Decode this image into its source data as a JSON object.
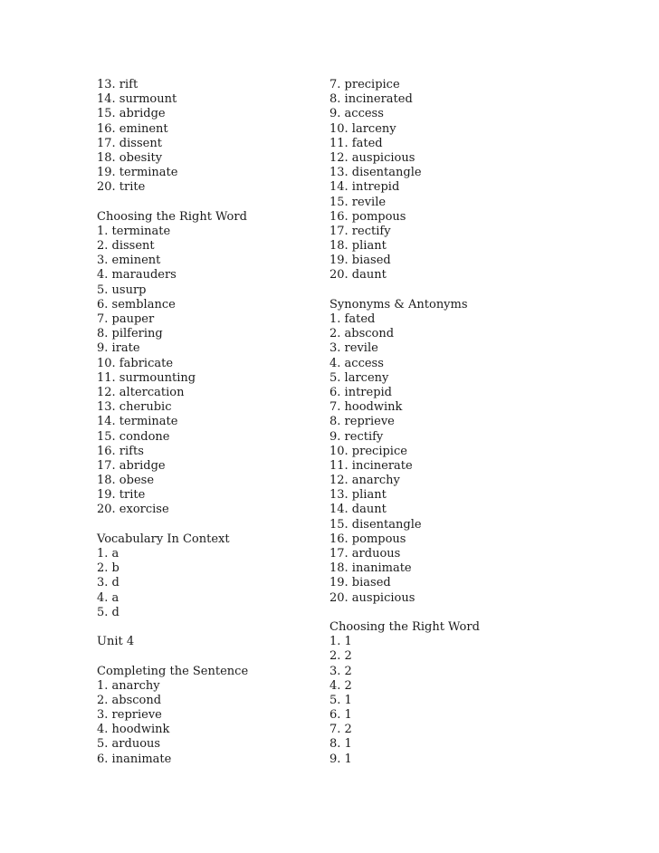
{
  "left_column": [
    {
      "heading": null,
      "items": [
        "13. rift",
        "14. surmount",
        "15. abridge",
        "16. eminent",
        "17. dissent",
        "18. obesity",
        "19. terminate",
        "20. trite"
      ]
    },
    {
      "heading": "Choosing the Right Word",
      "items": [
        "1. terminate",
        "2. dissent",
        "3. eminent",
        "4. marauders",
        "5. usurp",
        "6. semblance",
        "7. pauper",
        "8. pilfering",
        "9. irate",
        "10. fabricate",
        "11. surmounting",
        "12. altercation",
        "13. cherubic",
        "14. terminate",
        "15. condone",
        "16. rifts",
        "17. abridge",
        "18. obese",
        "19. trite",
        "20. exorcise"
      ]
    },
    {
      "heading": "Vocabulary In Context",
      "items": [
        "1. a",
        "2. b",
        "3. d",
        "4. a",
        "5. d"
      ]
    },
    {
      "heading": "Unit 4",
      "items": []
    },
    {
      "heading": "Completing the Sentence",
      "items": [
        "1. anarchy",
        "2. abscond",
        "3. reprieve",
        "4. hoodwink",
        "5. arduous",
        "6. inanimate"
      ]
    }
  ],
  "right_column": [
    {
      "heading": null,
      "items": [
        "7. precipice",
        "8. incinerated",
        "9. access",
        "10. larceny",
        "11. fated",
        "12. auspicious",
        "13. disentangle",
        "14. intrepid",
        "15. revile",
        "16. pompous",
        "17. rectify",
        "18. pliant",
        "19. biased",
        "20. daunt"
      ]
    },
    {
      "heading": "Synonyms & Antonyms",
      "items": [
        "1. fated",
        "2. abscond",
        "3. revile",
        "4. access",
        "5. larceny",
        "6. intrepid",
        "7. hoodwink",
        "8. reprieve",
        "9. rectify",
        "10. precipice",
        "11. incinerate",
        "12. anarchy",
        "13. pliant",
        "14. daunt",
        "15. disentangle",
        "16. pompous",
        "17. arduous",
        "18. inanimate",
        "19. biased",
        "20. auspicious"
      ]
    },
    {
      "heading": "Choosing the Right Word",
      "items": [
        "1. 1",
        "2. 2",
        "3. 2",
        "4. 2",
        "5. 1",
        "6. 1",
        "7. 2",
        "8. 1",
        "9. 1"
      ]
    }
  ]
}
